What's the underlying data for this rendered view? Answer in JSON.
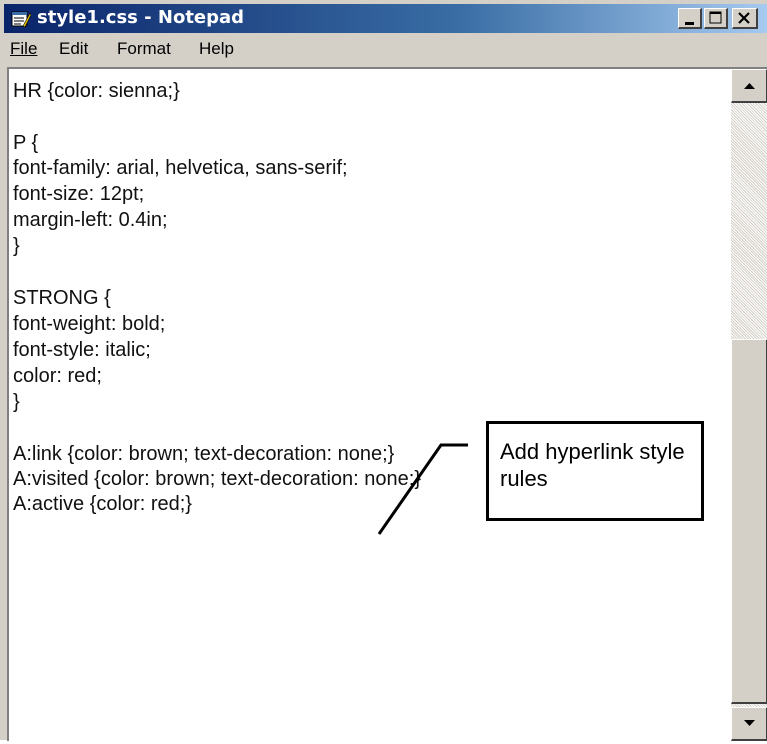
{
  "window": {
    "title": "style1.css - Notepad",
    "controls": {
      "minimize_icon": "minimize-icon",
      "maximize_icon": "maximize-icon",
      "close_icon": "close-icon"
    },
    "colors": {
      "title_bar_start": "#0a246a",
      "title_bar_end": "#a6caf0",
      "chrome": "#d4d0c8"
    }
  },
  "menu": {
    "file": "File",
    "edit": "Edit",
    "format": "Format",
    "help": "Help"
  },
  "editor": {
    "lines": [
      "HR {color: sienna;}",
      "",
      "P {",
      "font-family: arial, helvetica, sans-serif;",
      "font-size: 12pt;",
      "margin-left: 0.4in;",
      "}",
      "",
      "STRONG {",
      "font-weight: bold;",
      "font-style: italic;",
      "color: red;",
      "}",
      "",
      "A:link {color: brown; text-decoration: none;}",
      "A:visited {color: brown; text-decoration: none;}",
      "A:active {color: red;}"
    ]
  },
  "callout": {
    "text": "Add hyperlink style rules"
  }
}
